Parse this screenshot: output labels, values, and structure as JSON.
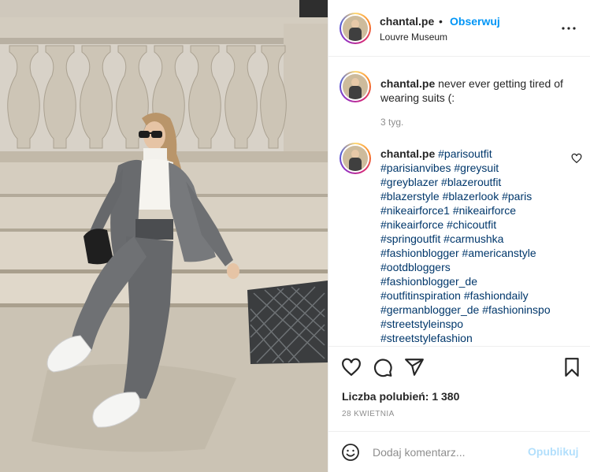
{
  "header": {
    "username": "chantal.pe",
    "separator": "•",
    "follow_label": "Obserwuj",
    "location": "Louvre Museum",
    "more_icon": "more-horizontal-icon"
  },
  "caption": {
    "username": "chantal.pe",
    "text": "never ever getting tired of wearing suits (:",
    "time": "3 tyg."
  },
  "hashtag_comment": {
    "username": "chantal.pe",
    "lines": [
      [
        "#parisoutfit"
      ],
      [
        "#parisianvibes",
        "#greysuit"
      ],
      [
        "#greyblazer",
        "#blazeroutfit"
      ],
      [
        "#blazerstyle",
        "#blazerlook",
        "#paris"
      ],
      [
        "#nikeairforce1",
        "#nikeairforce"
      ],
      [
        "#nikeairforce",
        "#chicoutfit"
      ],
      [
        "#springoutfit",
        "#carmushka"
      ],
      [
        "#fashionblogger",
        "#americanstyle"
      ],
      [
        "#ootdbloggers"
      ],
      [
        "#fashionblogger_de"
      ],
      [
        "#outfitinspiration",
        "#fashiondaily"
      ],
      [
        "#germanblogger_de",
        "#fashioninspo"
      ],
      [
        "#streetstyleinspo"
      ],
      [
        "#streetstylefashion"
      ]
    ]
  },
  "actions": {
    "like_icon": "heart-icon",
    "comment_icon": "comment-icon",
    "share_icon": "share-icon",
    "save_icon": "bookmark-icon",
    "likes_text": "Liczba polubień: 1 380",
    "date": "28 KWIETNIA"
  },
  "add_comment": {
    "placeholder": "Dodaj komentarz...",
    "post_label": "Opublikuj"
  },
  "colors": {
    "link_blue": "#0095f6",
    "hashtag": "#00376b",
    "muted": "#8e8e8e",
    "post_disabled": "#b2dffc"
  }
}
